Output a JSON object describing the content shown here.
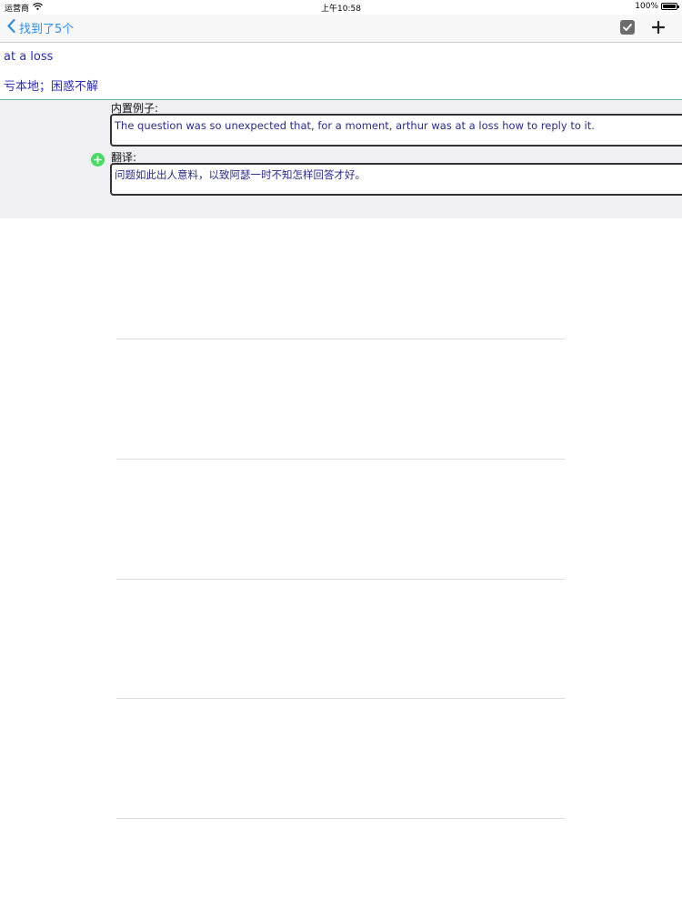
{
  "status_bar": {
    "carrier": "运营商",
    "time": "上午10:58",
    "battery": "100%"
  },
  "nav": {
    "back_label": "找到了5个",
    "icons": [
      "chevron-left-icon",
      "checkbox-icon",
      "plus-icon"
    ],
    "accent_color": "#2f8ee8"
  },
  "entry": {
    "word": "at a loss",
    "meaning": "亏本地；困惑不解",
    "text_color": "#2a2bb5"
  },
  "examples": {
    "builtin_label": "内置例子:",
    "builtin_text": "The question was so unexpected that, for a moment, arthur was at a loss how to reply to it.",
    "translation_label": "翻译:",
    "translation_text": "问题如此出人意料，以致阿瑟一时不知怎样回答才好。",
    "add_icon_color": "#4cd964"
  }
}
